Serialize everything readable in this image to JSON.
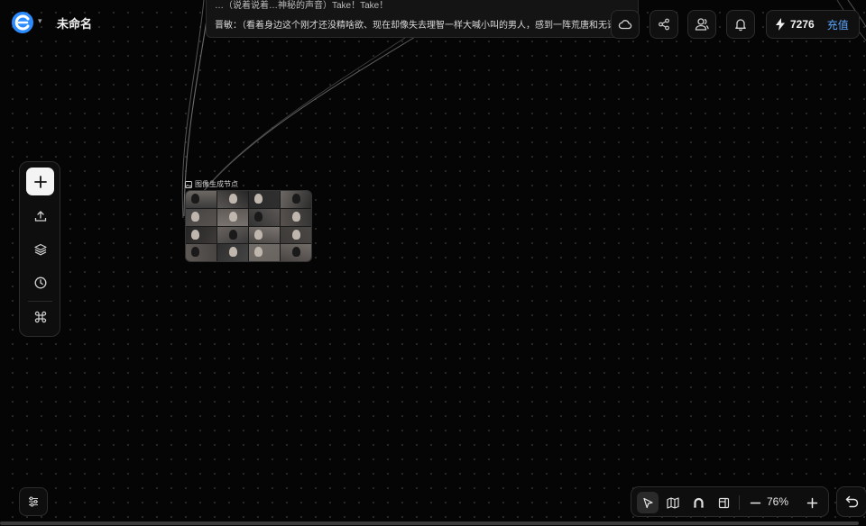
{
  "header": {
    "title": "未命名",
    "credits": "7276",
    "recharge_label": "充值"
  },
  "text_panel": {
    "line1": "…（说着说着…神秘的声音）Take！Take！",
    "line2": "晋敏：（看着身边这个刚才还没精啥欲、现在却像失去理智一样大喊小叫的男人，感到一阵荒唐和无语）“喂，现在那是真",
    "line3": "…"
  },
  "node": {
    "label": "图像生成节点"
  },
  "zoom": {
    "level": "76%"
  },
  "icons": {
    "logo": "app-logo-icon",
    "cloud": "cloud-icon",
    "share": "share-icon",
    "users": "users-icon",
    "bell": "bell-icon",
    "bolt": "bolt-icon",
    "add": "plus-icon",
    "upload": "upload-icon",
    "layers": "layers-icon",
    "history": "clock-icon",
    "shortcuts": "command-icon",
    "settings": "sliders-icon",
    "select": "pointer-icon",
    "map": "map-icon",
    "magnet": "magnet-icon",
    "panel": "panel-icon",
    "zoom_out": "minus-icon",
    "zoom_in": "plus-icon",
    "undo": "undo-icon"
  },
  "colors": {
    "accent": "#5aa7ff",
    "logo": "#3aa0ff"
  }
}
